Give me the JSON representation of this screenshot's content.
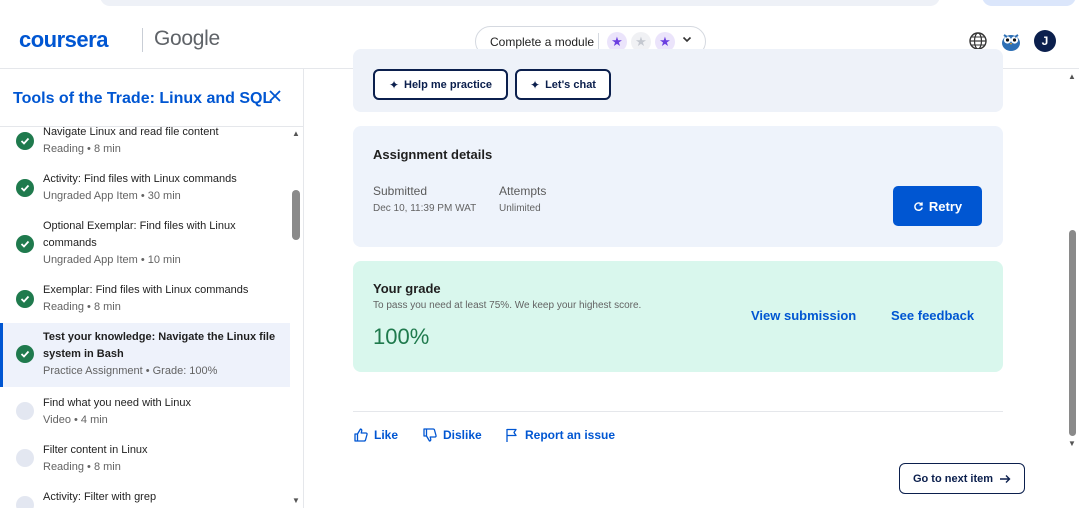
{
  "header": {
    "brand": "coursera",
    "partner": "Google",
    "module_pill_label": "Complete a module",
    "avatar_initial": "J"
  },
  "sidebar": {
    "title": "Tools of the Trade: Linux and SQL",
    "items": [
      {
        "name": "Navigate Linux and read file content",
        "meta": "Reading • 8 min",
        "status": "complete"
      },
      {
        "name": "Activity: Find files with Linux commands",
        "meta": "Ungraded App Item • 30 min",
        "status": "complete"
      },
      {
        "name": "Optional Exemplar: Find files with Linux commands",
        "meta": "Ungraded App Item • 10 min",
        "status": "complete"
      },
      {
        "name": "Exemplar: Find files with Linux commands",
        "meta": "Reading • 8 min",
        "status": "complete"
      },
      {
        "name": "Test your knowledge: Navigate the Linux file system in Bash",
        "meta": "Practice Assignment • Grade: 100%",
        "status": "complete",
        "active": true
      },
      {
        "name": "Find what you need with Linux",
        "meta": "Video • 4 min",
        "status": "incomplete"
      },
      {
        "name": "Filter content in Linux",
        "meta": "Reading • 8 min",
        "status": "incomplete"
      },
      {
        "name": "Activity: Filter with grep",
        "meta": "",
        "status": "incomplete"
      }
    ]
  },
  "main": {
    "help_practice": "Help me practice",
    "lets_chat": "Let's chat",
    "assignment": {
      "title": "Assignment details",
      "submitted_label": "Submitted",
      "submitted_value": "Dec 10, 11:39 PM WAT",
      "attempts_label": "Attempts",
      "attempts_value": "Unlimited",
      "retry": "Retry"
    },
    "grade": {
      "title": "Your grade",
      "subtitle": "To pass you need at least 75%. We keep your highest score.",
      "score": "100%",
      "view_submission": "View submission",
      "see_feedback": "See feedback"
    },
    "feedback": {
      "like": "Like",
      "dislike": "Dislike",
      "report": "Report an issue"
    },
    "next_item": "Go to next item"
  },
  "colors": {
    "brand_blue": "#0056d2",
    "navy": "#0b1f4d",
    "success_green": "#1f7a4d",
    "grade_bg": "#d9f7ed",
    "card_bg": "#eef3fb",
    "star_purple": "#6b3ee0"
  },
  "icons": {
    "close": "close-icon",
    "globe": "globe-icon",
    "owl": "owl-icon",
    "check": "check-icon",
    "sparkle": "sparkle-icon",
    "retry": "retry-icon",
    "thumbs_up": "thumbs-up-icon",
    "thumbs_down": "thumbs-down-icon",
    "flag": "flag-icon",
    "arrow_right": "arrow-right-icon"
  }
}
